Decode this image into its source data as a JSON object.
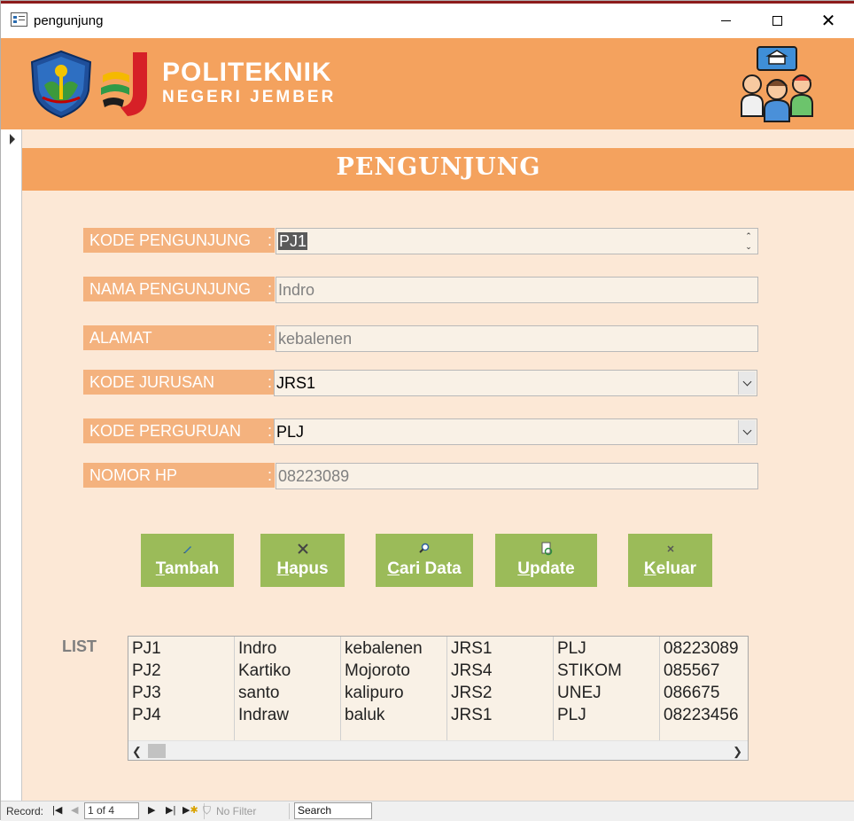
{
  "window": {
    "title": "pengunjung"
  },
  "header": {
    "brand_line1": "POLITEKNIK",
    "brand_line2": "NEGERI JEMBER",
    "background": "#f4a25e"
  },
  "form": {
    "title": "PENGUNJUNG",
    "fields": [
      {
        "label": "KODE PENGUNJUNG",
        "colon": ":",
        "value": "PJ1",
        "type": "spinner"
      },
      {
        "label": "NAMA PENGUNJUNG",
        "colon": ":",
        "value": "Indro",
        "type": "text"
      },
      {
        "label": "ALAMAT",
        "colon": ":",
        "value": "kebalenen",
        "type": "text"
      },
      {
        "label": "KODE JURUSAN",
        "colon": ":",
        "value": "JRS1",
        "type": "combo"
      },
      {
        "label": "KODE PERGURUAN",
        "colon": ":",
        "value": "PLJ",
        "type": "combo"
      },
      {
        "label": "NOMOR HP",
        "colon": ":",
        "value": "08223089",
        "type": "text"
      }
    ]
  },
  "buttons": [
    {
      "key": "T",
      "rest": "ambah",
      "icon": "pencil-icon"
    },
    {
      "key": "H",
      "rest": "apus",
      "icon": "delete-x-icon"
    },
    {
      "key": "C",
      "rest": "ari Data",
      "icon": "magnifier-icon"
    },
    {
      "key": "U",
      "rest": "pdate",
      "icon": "refresh-document-icon"
    },
    {
      "key": "K",
      "rest": "eluar",
      "icon": "close-x-icon"
    }
  ],
  "list": {
    "label": "LIST",
    "rows": [
      [
        "PJ1",
        "Indro",
        "kebalenen",
        "JRS1",
        "PLJ",
        "08223089"
      ],
      [
        "PJ2",
        "Kartiko",
        "Mojoroto",
        "JRS4",
        "STIKOM",
        "085567"
      ],
      [
        "PJ3",
        "santo",
        "kalipuro",
        "JRS2",
        "UNEJ",
        "086675"
      ],
      [
        "PJ4",
        "Indraw",
        "baluk",
        "JRS1",
        "PLJ",
        "08223456"
      ]
    ]
  },
  "navigation": {
    "record_label": "Record:",
    "position": "1 of 4",
    "filter": "No Filter",
    "search": "Search"
  }
}
